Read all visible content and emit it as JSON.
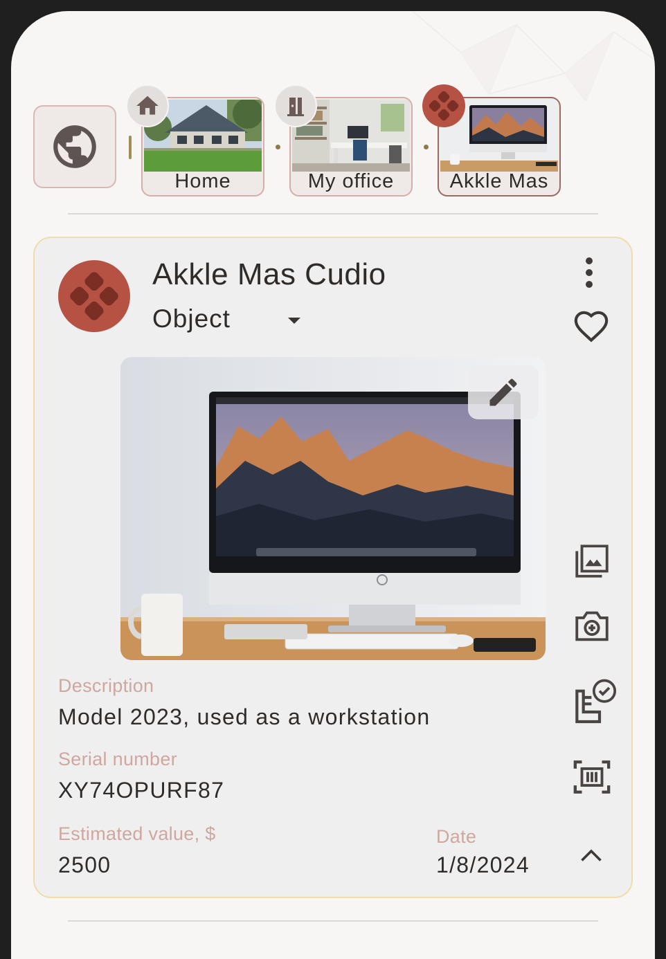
{
  "breadcrumb": {
    "items": [
      {
        "label": "Home",
        "icon": "home-icon"
      },
      {
        "label": "My office",
        "icon": "door-icon"
      },
      {
        "label": "Akkle Mas",
        "icon": "object-logo-icon"
      }
    ]
  },
  "item": {
    "title": "Akkle Mas Cudio",
    "type": "Object",
    "fields": {
      "description_label": "Description",
      "description": "Model 2023, used as a workstation",
      "serial_label": "Serial number",
      "serial": "XY74OPURF87",
      "value_label": "Estimated value, $",
      "value": "2500",
      "date_label": "Date",
      "date": "1/8/2024"
    }
  },
  "colors": {
    "accent": "#b65243",
    "label": "#cfa79f",
    "card_border": "#f0dca7",
    "background": "#f7f6f5"
  }
}
